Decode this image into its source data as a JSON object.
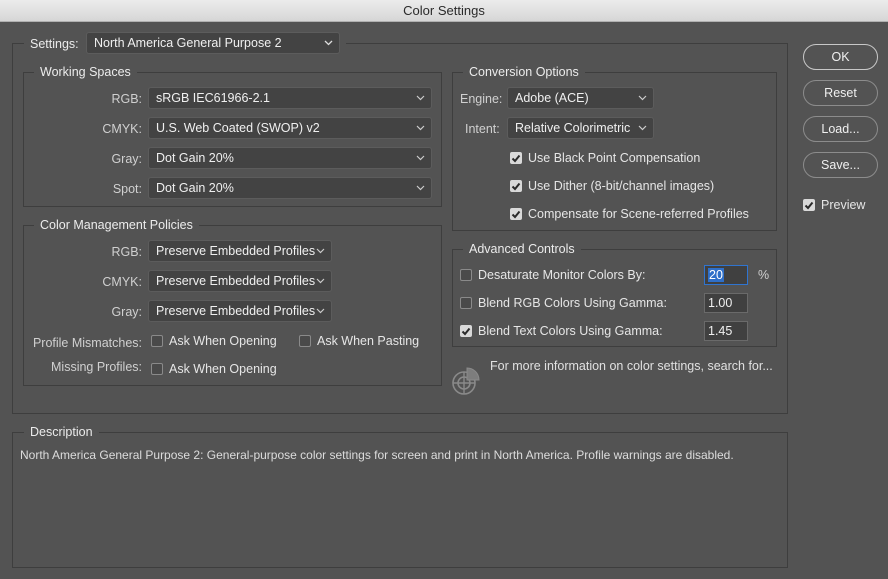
{
  "window": {
    "title": "Color Settings"
  },
  "settings": {
    "label": "Settings:",
    "value": "North America General Purpose 2"
  },
  "working_spaces": {
    "title": "Working Spaces",
    "rows": [
      {
        "label": "RGB:",
        "value": "sRGB IEC61966-2.1"
      },
      {
        "label": "CMYK:",
        "value": "U.S. Web Coated (SWOP) v2"
      },
      {
        "label": "Gray:",
        "value": "Dot Gain 20%"
      },
      {
        "label": "Spot:",
        "value": "Dot Gain 20%"
      }
    ]
  },
  "policies": {
    "title": "Color Management Policies",
    "rows": [
      {
        "label": "RGB:",
        "value": "Preserve Embedded Profiles"
      },
      {
        "label": "CMYK:",
        "value": "Preserve Embedded Profiles"
      },
      {
        "label": "Gray:",
        "value": "Preserve Embedded Profiles"
      }
    ],
    "mismatches_label": "Profile Mismatches:",
    "ask_opening": {
      "label": "Ask When Opening",
      "checked": false
    },
    "ask_pasting": {
      "label": "Ask When Pasting",
      "checked": false
    },
    "missing_label": "Missing Profiles:",
    "missing_ask_opening": {
      "label": "Ask When Opening",
      "checked": false
    }
  },
  "conversion": {
    "title": "Conversion Options",
    "engine_label": "Engine:",
    "engine_value": "Adobe (ACE)",
    "intent_label": "Intent:",
    "intent_value": "Relative Colorimetric",
    "black_point": {
      "label": "Use Black Point Compensation",
      "checked": true
    },
    "dither": {
      "label": "Use Dither (8-bit/channel images)",
      "checked": true
    },
    "scene_referred": {
      "label": "Compensate for Scene-referred Profiles",
      "checked": true
    }
  },
  "advanced": {
    "title": "Advanced Controls",
    "desaturate": {
      "label": "Desaturate Monitor Colors By:",
      "checked": false,
      "value": "20",
      "unit": "%"
    },
    "blend_rgb": {
      "label": "Blend RGB Colors Using Gamma:",
      "checked": false,
      "value": "1.00"
    },
    "blend_text": {
      "label": "Blend Text Colors Using Gamma:",
      "checked": true,
      "value": "1.45"
    }
  },
  "info": {
    "text": "For more information on color settings, search for..."
  },
  "description": {
    "title": "Description",
    "text": "North America General Purpose 2:  General-purpose color settings for screen and print in North America. Profile warnings are disabled."
  },
  "buttons": {
    "ok": "OK",
    "reset": "Reset",
    "load": "Load...",
    "save": "Save..."
  },
  "preview": {
    "label": "Preview",
    "checked": true
  },
  "colors": {
    "background": "#535353",
    "focus": "#2f74d0"
  }
}
